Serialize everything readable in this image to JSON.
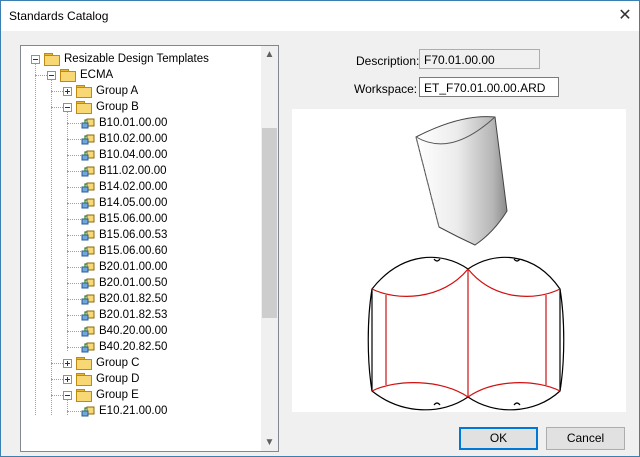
{
  "window": {
    "title": "Standards Catalog",
    "close_glyph": "✕"
  },
  "tree": {
    "items": [
      {
        "label": "Resizable Design Templates",
        "type": "folder",
        "level": 0,
        "expander": "minus"
      },
      {
        "label": "ECMA",
        "type": "folder",
        "level": 1,
        "expander": "minus"
      },
      {
        "label": "Group A",
        "type": "folder",
        "level": 2,
        "expander": "plus"
      },
      {
        "label": "Group B",
        "type": "folder",
        "level": 2,
        "expander": "minus"
      },
      {
        "label": "B10.01.00.00",
        "type": "template",
        "level": 3
      },
      {
        "label": "B10.02.00.00",
        "type": "template",
        "level": 3
      },
      {
        "label": "B10.04.00.00",
        "type": "template",
        "level": 3
      },
      {
        "label": "B11.02.00.00",
        "type": "template",
        "level": 3
      },
      {
        "label": "B14.02.00.00",
        "type": "template",
        "level": 3
      },
      {
        "label": "B14.05.00.00",
        "type": "template",
        "level": 3
      },
      {
        "label": "B15.06.00.00",
        "type": "template",
        "level": 3
      },
      {
        "label": "B15.06.00.53",
        "type": "template",
        "level": 3
      },
      {
        "label": "B15.06.00.60",
        "type": "template",
        "level": 3
      },
      {
        "label": "B20.01.00.00",
        "type": "template",
        "level": 3
      },
      {
        "label": "B20.01.00.50",
        "type": "template",
        "level": 3
      },
      {
        "label": "B20.01.82.50",
        "type": "template",
        "level": 3
      },
      {
        "label": "B20.01.82.53",
        "type": "template",
        "level": 3
      },
      {
        "label": "B40.20.00.00",
        "type": "template",
        "level": 3
      },
      {
        "label": "B40.20.82.50",
        "type": "template",
        "level": 3
      },
      {
        "label": "Group C",
        "type": "folder",
        "level": 2,
        "expander": "plus"
      },
      {
        "label": "Group D",
        "type": "folder",
        "level": 2,
        "expander": "plus"
      },
      {
        "label": "Group E",
        "type": "folder",
        "level": 2,
        "expander": "minus"
      },
      {
        "label": "E10.21.00.00",
        "type": "template",
        "level": 3
      }
    ],
    "scroll_up_glyph": "▲",
    "scroll_down_glyph": "▼"
  },
  "details": {
    "description_label": "Description:",
    "description_value": "F70.01.00.00",
    "workspace_label": "Workspace:",
    "workspace_value": "ET_F70.01.00.00.ARD"
  },
  "buttons": {
    "ok": "OK",
    "cancel": "Cancel"
  },
  "colors": {
    "fold_lines": "#d01010",
    "accent": "#0078d7"
  }
}
